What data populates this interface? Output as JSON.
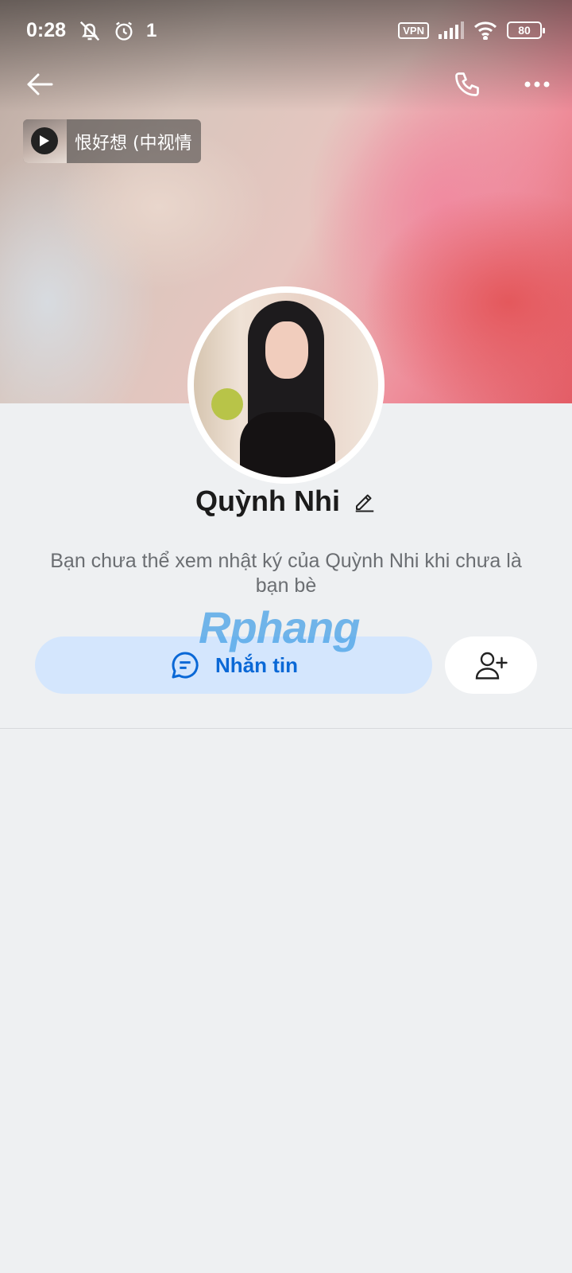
{
  "status_bar": {
    "time": "0:28",
    "extra_indicator": "1",
    "vpn_label": "VPN",
    "battery_level": "80"
  },
  "cover": {
    "music_title": "恨好想 (中视情"
  },
  "profile": {
    "name": "Quỳnh Nhi",
    "notice": "Bạn chưa thể xem nhật ký của Quỳnh Nhi khi chưa là bạn bè"
  },
  "actions": {
    "message_label": "Nhắn tin"
  },
  "watermark": {
    "text": "Rphang"
  },
  "icons": {
    "back": "back-arrow-icon",
    "call": "phone-icon",
    "more": "more-dots-icon",
    "edit": "pencil-icon",
    "message": "chat-bubble-icon",
    "add_friend": "add-user-icon",
    "play": "play-icon"
  },
  "colors": {
    "accent": "#0a68d6",
    "message_button_bg": "#d4e6fd",
    "page_bg": "#eef0f2"
  }
}
